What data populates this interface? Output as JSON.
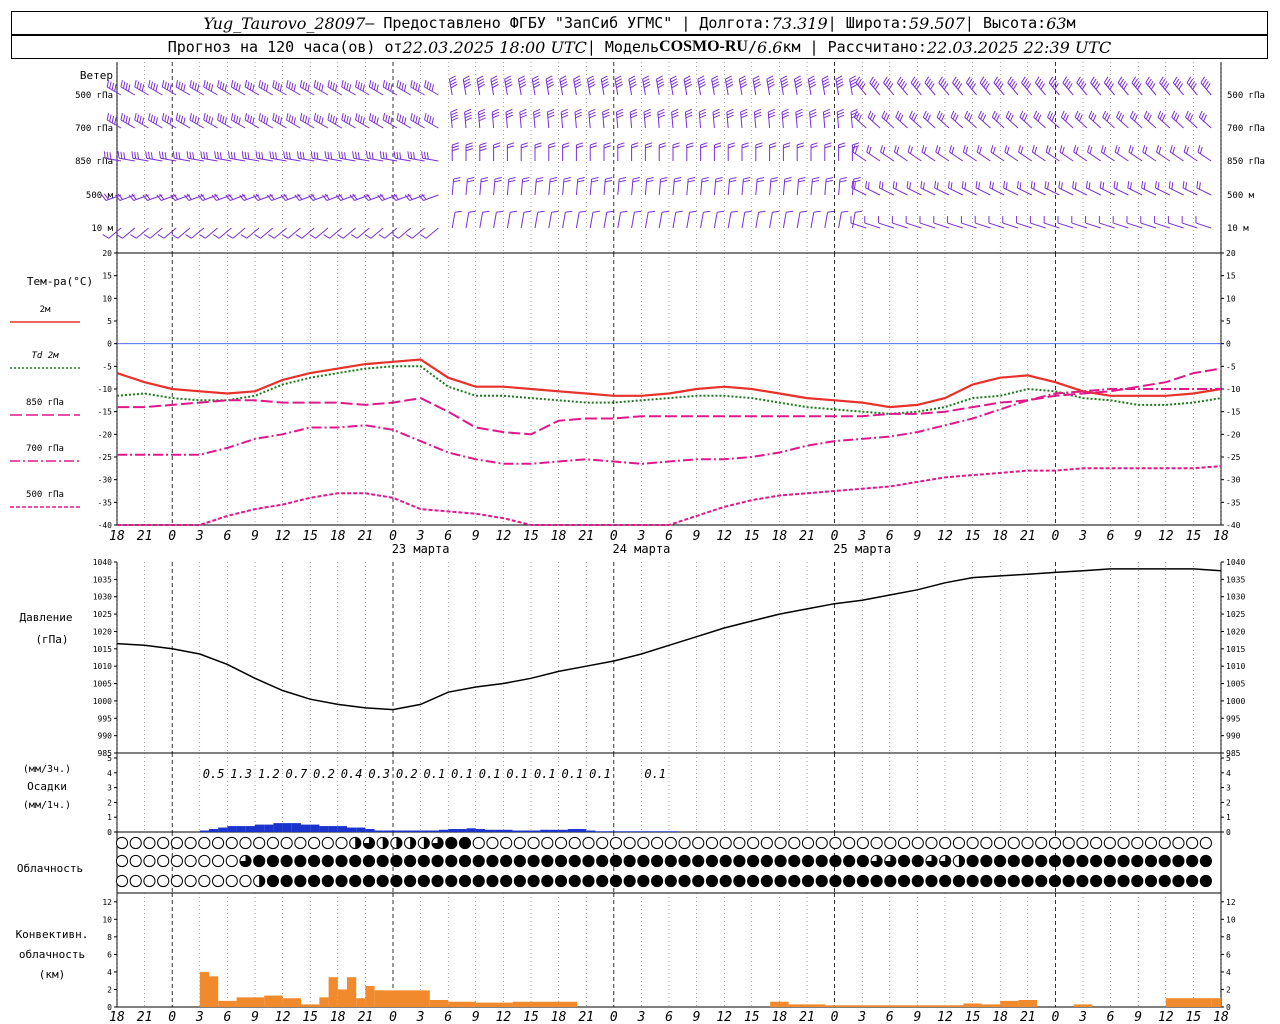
{
  "header": {
    "station": "Yug_Taurovo_28097",
    "provider": " – Предоставлено ФГБУ \"ЗапСиб УГМС\" | Долгота: ",
    "lon": "73.319",
    "lat_label": " | Широта: ",
    "lat": "59.507",
    "alt_label": " | Высота: ",
    "alt": "63",
    "alt_unit": "м",
    "forecast_label": "Прогноз на 120 часа(ов) от ",
    "start": "22.03.2025 18:00 UTC",
    "model_label": "  | Модель ",
    "model": "COSMO-RU",
    "model_sep": " / ",
    "res": "6.6",
    "res_unit": "км | Рассчитано: ",
    "calc": "22.03.2025 22:39 UTC"
  },
  "time_axis": {
    "hour_labels": [
      "18",
      "21",
      "0",
      "3",
      "6",
      "9",
      "12",
      "15",
      "18",
      "21",
      "0",
      "3",
      "6",
      "9",
      "12",
      "15",
      "18",
      "21",
      "0",
      "3",
      "6",
      "9",
      "12",
      "15",
      "18",
      "21",
      "0"
    ],
    "day_labels": [
      {
        "text": "23 марта",
        "at_hour": 33
      },
      {
        "text": "24 марта",
        "at_hour": 57
      },
      {
        "text": "25 марта",
        "at_hour": 81
      }
    ],
    "midnights_hours": [
      6,
      30,
      54,
      78,
      102
    ]
  },
  "wind": {
    "title": "Ветер",
    "levels": [
      "500 гПа",
      "700 гПа",
      "850 гПа",
      "500 м",
      "10  м"
    ],
    "color": "#7b2fd6"
  },
  "chart_data": [
    {
      "type": "line",
      "title": "Тем-ра(°C)",
      "ylim": [
        -40,
        20
      ],
      "yticks": [
        "20",
        "15",
        "10",
        "5",
        "0",
        "-5",
        "-10",
        "-15",
        "-20",
        "-25",
        "-30",
        "-35",
        "-40"
      ],
      "x_hours": [
        0,
        3,
        6,
        9,
        12,
        15,
        18,
        21,
        24,
        27,
        30,
        33,
        36,
        39,
        42,
        45,
        48,
        51,
        54,
        57,
        60,
        63,
        66,
        69,
        72,
        75,
        78,
        81,
        84,
        87,
        90,
        93,
        96,
        99,
        102,
        105,
        108,
        111,
        114,
        117,
        120
      ],
      "series": [
        {
          "name": "2м",
          "color": "#e8312a",
          "style": "solid",
          "values": [
            -6.5,
            -8.5,
            -10,
            -10.5,
            -11,
            -10.5,
            -8,
            -6.5,
            -5.5,
            -4.5,
            -4,
            -3.5,
            -7.5,
            -9.5,
            -9.5,
            -10,
            -10.5,
            -11,
            -11.5,
            -11.5,
            -11,
            -10,
            -9.5,
            -10,
            -11,
            -12,
            -12.5,
            -13,
            -14,
            -13.5,
            -12,
            -9,
            -7.5,
            -7,
            -8.5,
            -10.5,
            -11.5,
            -11.5,
            -11.5,
            -11,
            -10
          ]
        },
        {
          "name": "Td  2м",
          "color": "#1c7a1c",
          "style": "dotted",
          "values": [
            -11.5,
            -11,
            -12,
            -12.5,
            -12.5,
            -11.5,
            -9,
            -7.5,
            -6.5,
            -5.5,
            -5,
            -5,
            -9.5,
            -11.5,
            -11.5,
            -12,
            -12.5,
            -13,
            -13,
            -12.5,
            -12,
            -11.5,
            -11.5,
            -12,
            -13,
            -14,
            -14.5,
            -15,
            -15.5,
            -15,
            -14,
            -12,
            -11.5,
            -10,
            -10.5,
            -12,
            -12.5,
            -13.5,
            -13.5,
            -13,
            -12
          ]
        },
        {
          "name": "850 гПа",
          "color": "#e0188c",
          "style": "longdash",
          "values": [
            -14,
            -14,
            -13.5,
            -13,
            -12.5,
            -12.5,
            -13,
            -13,
            -13,
            -13.5,
            -13,
            -12,
            -15,
            -18.5,
            -19.5,
            -20,
            -17,
            -16.5,
            -16.5,
            -16,
            -16,
            -16,
            -16,
            -16,
            -16,
            -16,
            -16,
            -16,
            -15.5,
            -15.5,
            -15,
            -14,
            -13,
            -12.5,
            -11.5,
            -11,
            -10.5,
            -9.5,
            -8.5,
            -6.5,
            -5.5
          ]
        },
        {
          "name": "700 гПа",
          "color": "#e0188c",
          "style": "dashdot",
          "values": [
            -24.5,
            -24.5,
            -24.5,
            -24.5,
            -23,
            -21,
            -20,
            -18.5,
            -18.5,
            -18,
            -19,
            -21.5,
            -24,
            -25.5,
            -26.5,
            -26.5,
            -26,
            -25.5,
            -26,
            -26.5,
            -26,
            -25.5,
            -25.5,
            -25,
            -24,
            -22.5,
            -21.5,
            -21,
            -20.5,
            -19.5,
            -18,
            -16.5,
            -14.5,
            -12.5,
            -11,
            -10.5,
            -10,
            -10,
            -10,
            -10,
            -10
          ]
        },
        {
          "name": "500 гПа",
          "color": "#e0188c",
          "style": "shortdash",
          "values": [
            -40.5,
            -41,
            -41,
            -40,
            -38,
            -36.5,
            -35.5,
            -34,
            -33,
            -33,
            -34,
            -36.5,
            -37,
            -37.5,
            -38.5,
            -40,
            -41,
            -42,
            -41,
            -40,
            -40,
            -38,
            -36,
            -34.5,
            -33.5,
            -33,
            -32.5,
            -32,
            -31.5,
            -30.5,
            -29.5,
            -29,
            -28.5,
            -28,
            -28,
            -27.5,
            -27.5,
            -27.5,
            -27.5,
            -27.5,
            -27
          ]
        }
      ]
    },
    {
      "type": "line",
      "title": "Давление",
      "ylabel": "(гПа)",
      "ylim": [
        985,
        1040
      ],
      "yticks": [
        "1040",
        "1035",
        "1030",
        "1025",
        "1020",
        "1015",
        "1010",
        "1005",
        "1000",
        "995",
        "990",
        "985"
      ],
      "x_hours": [
        0,
        3,
        6,
        9,
        12,
        15,
        18,
        21,
        24,
        27,
        30,
        33,
        36,
        39,
        42,
        45,
        48,
        51,
        54,
        57,
        60,
        63,
        66,
        69,
        72,
        75,
        78,
        81,
        84,
        87,
        90,
        93,
        96,
        99,
        102,
        105,
        108,
        111,
        114,
        117,
        120
      ],
      "series": [
        {
          "name": "",
          "color": "#000000",
          "values": [
            1016.5,
            1016,
            1015,
            1013.5,
            1010.5,
            1006.5,
            1003,
            1000.5,
            999,
            998,
            997.5,
            999,
            1002.5,
            1004,
            1005,
            1006.5,
            1008.5,
            1010,
            1011.5,
            1013.5,
            1016,
            1018.5,
            1021,
            1023,
            1025,
            1026.5,
            1028,
            1029,
            1030.5,
            1032,
            1034,
            1035.5,
            1036,
            1036.5,
            1037,
            1037.5,
            1038,
            1038,
            1038,
            1038,
            1037.5
          ]
        }
      ]
    },
    {
      "type": "bar",
      "title": "Осадки",
      "ylabel_top": "(мм/3ч.)",
      "ylabel_bottom": "(мм/1ч.)",
      "ylim": [
        0,
        5
      ],
      "yticks": [
        "5",
        "4",
        "3",
        "2",
        "1",
        "0"
      ],
      "color": "#1a33cc",
      "x_hours": [
        9,
        10,
        11,
        12,
        13,
        14,
        15,
        16,
        17,
        18,
        19,
        20,
        21,
        22,
        23,
        24,
        25,
        26,
        27,
        28,
        29,
        30,
        31,
        32,
        33,
        34,
        35,
        36,
        37,
        38,
        39,
        40,
        41,
        42,
        43,
        44,
        45,
        46,
        47,
        48,
        49,
        50,
        51,
        52,
        53,
        54,
        55,
        56,
        57,
        58,
        59,
        60
      ],
      "values": [
        0.1,
        0.2,
        0.3,
        0.4,
        0.4,
        0.4,
        0.5,
        0.5,
        0.6,
        0.6,
        0.6,
        0.5,
        0.5,
        0.4,
        0.4,
        0.4,
        0.3,
        0.3,
        0.2,
        0.1,
        0.1,
        0.1,
        0.1,
        0.1,
        0.1,
        0.1,
        0.15,
        0.2,
        0.2,
        0.25,
        0.2,
        0.15,
        0.15,
        0.15,
        0.1,
        0.1,
        0.1,
        0.15,
        0.15,
        0.15,
        0.2,
        0.2,
        0.1,
        0.05,
        0.05,
        0.05,
        0.05,
        0.05,
        0.05,
        0.05,
        0.05,
        0.05
      ],
      "labels_3h": [
        {
          "hour": 10.5,
          "text": "0.5"
        },
        {
          "hour": 13.5,
          "text": "1.3"
        },
        {
          "hour": 16.5,
          "text": "1.2"
        },
        {
          "hour": 19.5,
          "text": "0.7"
        },
        {
          "hour": 22.5,
          "text": "0.2"
        },
        {
          "hour": 25.5,
          "text": "0.4"
        },
        {
          "hour": 28.5,
          "text": "0.3"
        },
        {
          "hour": 31.5,
          "text": "0.2"
        },
        {
          "hour": 34.5,
          "text": "0.1"
        },
        {
          "hour": 37.5,
          "text": "0.1"
        },
        {
          "hour": 40.5,
          "text": "0.1"
        },
        {
          "hour": 43.5,
          "text": "0.1"
        },
        {
          "hour": 46.5,
          "text": "0.1"
        },
        {
          "hour": 49.5,
          "text": "0.1"
        },
        {
          "hour": 52.5,
          "text": "0.1"
        },
        {
          "hour": 58.5,
          "text": "0.1"
        }
      ]
    },
    {
      "type": "heatmap",
      "title": "Облачность",
      "rows_oktas": [
        "000000000000000004654457881100000000000000000000000000000000000000000000000000000000000000000000000000000000000000000000000000000000000000000000000000000000000000000000000000000000000000000000000000000000000000000000000000000000004688868",
        "000000000688888888888888888888888888888888888888888888866886648888888888888888888888888888888888888888888000000000000000000000000000000000000000000000000000000000000000000000000000000000000000000000000000000000000000000000000000000000000000000000000000000000000000000000000000000000000000000000000000000000000000000000000000000004688668",
        "000000000048888888888888888888888888888888888888888888888888888888888888888888888888888888888888888888888884000000000000000000088888888888888888888888888888888888888888888888888888888888888888888888888888888888888888888888888888888888888888888888888888888888888888888888888888888888888888888888888888888888888888888888888888888"
      ]
    },
    {
      "type": "bar",
      "title": "Конвективн.",
      "title2": "облачность",
      "ylabel": "(км)",
      "ylim": [
        0,
        13
      ],
      "yticks": [
        "12",
        "10",
        "8",
        "6",
        "4",
        "2",
        "0"
      ],
      "color": "#f08a2c",
      "bars": [
        {
          "h0": 9,
          "h1": 10,
          "val": 4
        },
        {
          "h0": 10,
          "h1": 11,
          "val": 3.5
        },
        {
          "h0": 11,
          "h1": 13,
          "val": 0.7
        },
        {
          "h0": 13,
          "h1": 16,
          "val": 1.1
        },
        {
          "h0": 16,
          "h1": 18,
          "val": 1.3
        },
        {
          "h0": 18,
          "h1": 20,
          "val": 1.0
        },
        {
          "h0": 20,
          "h1": 22,
          "val": 0.3
        },
        {
          "h0": 22,
          "h1": 23,
          "val": 1.1
        },
        {
          "h0": 23,
          "h1": 24,
          "val": 3.4
        },
        {
          "h0": 24,
          "h1": 25,
          "val": 2.0
        },
        {
          "h0": 25,
          "h1": 26,
          "val": 3.4
        },
        {
          "h0": 26,
          "h1": 27,
          "val": 1.0
        },
        {
          "h0": 27,
          "h1": 28,
          "val": 2.4
        },
        {
          "h0": 28,
          "h1": 34,
          "val": 1.9
        },
        {
          "h0": 34,
          "h1": 36,
          "val": 0.8
        },
        {
          "h0": 36,
          "h1": 39,
          "val": 0.6
        },
        {
          "h0": 39,
          "h1": 43,
          "val": 0.5
        },
        {
          "h0": 43,
          "h1": 50,
          "val": 0.6
        },
        {
          "h0": 71,
          "h1": 73,
          "val": 0.6
        },
        {
          "h0": 73,
          "h1": 75,
          "val": 0.3
        },
        {
          "h0": 75,
          "h1": 77,
          "val": 0.3
        },
        {
          "h0": 77,
          "h1": 92,
          "val": 0.2
        },
        {
          "h0": 92,
          "h1": 94,
          "val": 0.4
        },
        {
          "h0": 94,
          "h1": 96,
          "val": 0.3
        },
        {
          "h0": 96,
          "h1": 98,
          "val": 0.7
        },
        {
          "h0": 98,
          "h1": 100,
          "val": 0.8
        },
        {
          "h0": 104,
          "h1": 106,
          "val": 0.3
        },
        {
          "h0": 114,
          "h1": 119,
          "val": 1.0
        },
        {
          "h0": 119,
          "h1": 120,
          "val": 1.0
        }
      ]
    }
  ]
}
